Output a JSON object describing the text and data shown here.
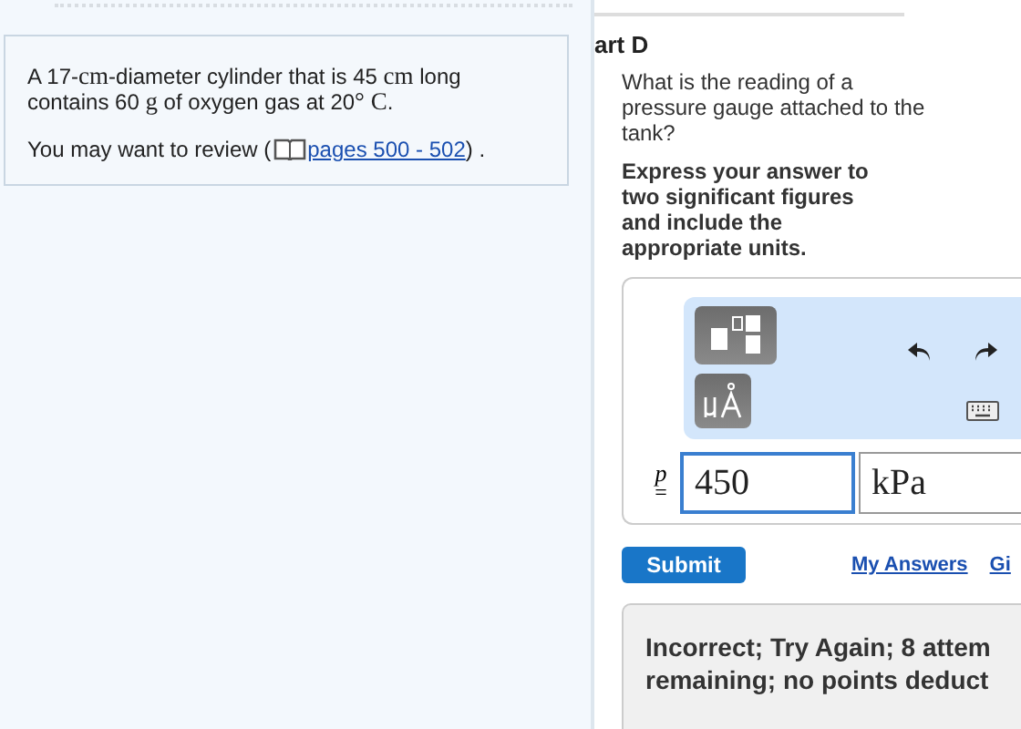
{
  "problem": {
    "statement": [
      {
        "kind": "text",
        "text": "A 17-"
      },
      {
        "kind": "math",
        "text": "cm"
      },
      {
        "kind": "text",
        "text": "-diameter cylinder that is 45 "
      },
      {
        "kind": "math",
        "text": "cm"
      },
      {
        "kind": "text",
        "text": " long contains 60 "
      },
      {
        "kind": "math",
        "text": "g"
      },
      {
        "kind": "text",
        "text": " of oxygen gas at 20"
      },
      {
        "kind": "math",
        "text": "° C"
      },
      {
        "kind": "text",
        "text": "."
      }
    ],
    "review_prefix": "You may want to review (",
    "review_link": "pages 500 - 502",
    "review_suffix": ") ."
  },
  "part": {
    "title": "art D",
    "question": "What is the reading of a pressure gauge attached to the tank?",
    "instruction": "Express your answer to two significant figures and include the appropriate units."
  },
  "answer": {
    "variable": "p",
    "equals": "=",
    "value": "450",
    "unit": "kPa"
  },
  "actions": {
    "submit": "Submit",
    "my_answers": "My Answers",
    "give_up": "Gi"
  },
  "feedback": {
    "lines": [
      "Incorrect; Try Again; 8 attem",
      "remaining; no points deduct"
    ]
  }
}
